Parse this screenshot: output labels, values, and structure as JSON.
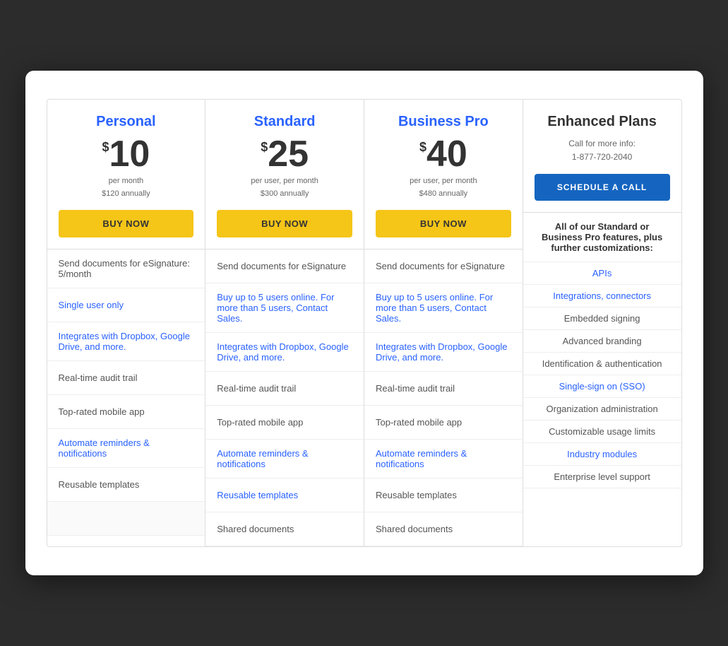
{
  "plans": [
    {
      "id": "personal",
      "name": "Personal",
      "name_color": "blue",
      "price_symbol": "$",
      "price_amount": "10",
      "price_period": "per month",
      "price_annual": "$120 annually",
      "buy_label": "BUY NOW",
      "features": [
        {
          "text": "Send documents for eSignature: 5/month",
          "highlighted": false
        },
        {
          "text": "Single user only",
          "highlighted": true
        },
        {
          "text": "Integrates with Dropbox, Google Drive, and more.",
          "highlighted": true
        },
        {
          "text": "Real-time audit trail",
          "highlighted": false
        },
        {
          "text": "Top-rated mobile app",
          "highlighted": false
        },
        {
          "text": "Automate reminders & notifications",
          "highlighted": true
        },
        {
          "text": "Reusable templates",
          "highlighted": false
        },
        {
          "text": "",
          "highlighted": false,
          "empty": true
        }
      ]
    },
    {
      "id": "standard",
      "name": "Standard",
      "name_color": "blue",
      "price_symbol": "$",
      "price_amount": "25",
      "price_period": "per user, per month",
      "price_annual": "$300 annually",
      "buy_label": "BUY NOW",
      "features": [
        {
          "text": "Send documents for eSignature",
          "highlighted": false
        },
        {
          "text": "Buy up to 5 users online. For more than 5 users, Contact Sales.",
          "highlighted": true
        },
        {
          "text": "Integrates with Dropbox, Google Drive, and more.",
          "highlighted": true
        },
        {
          "text": "Real-time audit trail",
          "highlighted": false
        },
        {
          "text": "Top-rated mobile app",
          "highlighted": false
        },
        {
          "text": "Automate reminders & notifications",
          "highlighted": true
        },
        {
          "text": "Reusable templates",
          "highlighted": true
        },
        {
          "text": "Shared documents",
          "highlighted": false
        }
      ]
    },
    {
      "id": "business-pro",
      "name": "Business Pro",
      "name_color": "blue",
      "price_symbol": "$",
      "price_amount": "40",
      "price_period": "per user, per month",
      "price_annual": "$480 annually",
      "buy_label": "BUY NOW",
      "features": [
        {
          "text": "Send documents for eSignature",
          "highlighted": false
        },
        {
          "text": "Buy up to 5 users online. For more than 5 users, Contact Sales.",
          "highlighted": true
        },
        {
          "text": "Integrates with Dropbox, Google Drive, and more.",
          "highlighted": true
        },
        {
          "text": "Real-time audit trail",
          "highlighted": false
        },
        {
          "text": "Top-rated mobile app",
          "highlighted": false
        },
        {
          "text": "Automate reminders & notifications",
          "highlighted": true
        },
        {
          "text": "Reusable templates",
          "highlighted": false
        },
        {
          "text": "Shared documents",
          "highlighted": false
        }
      ]
    }
  ],
  "enhanced": {
    "name": "Enhanced Plans",
    "call_label": "Call for more info:",
    "phone": "1-877-720-2040",
    "schedule_label": "SCHEDULE A CALL",
    "intro": "All of our Standard or Business Pro features, plus further customizations:",
    "features": [
      {
        "text": "APIs",
        "blue": true
      },
      {
        "text": "Integrations, connectors",
        "blue": true
      },
      {
        "text": "Embedded signing",
        "blue": false
      },
      {
        "text": "Advanced branding",
        "blue": false
      },
      {
        "text": "Identification & authentication",
        "blue": false
      },
      {
        "text": "Single-sign on (SSO)",
        "blue": true
      },
      {
        "text": "Organization administration",
        "blue": false
      },
      {
        "text": "Customizable usage limits",
        "blue": false
      },
      {
        "text": "Industry modules",
        "blue": true
      },
      {
        "text": "Enterprise level support",
        "blue": false
      }
    ]
  }
}
